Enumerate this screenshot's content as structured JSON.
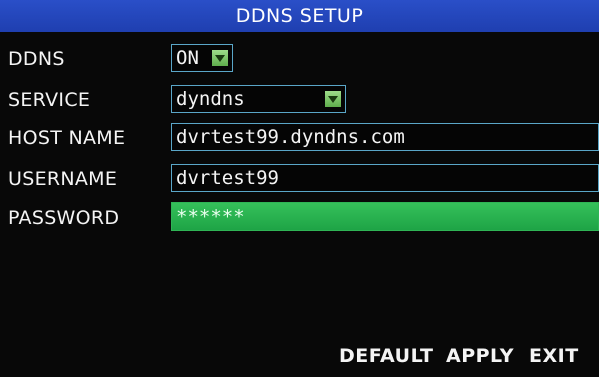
{
  "header": {
    "title": "DDNS SETUP"
  },
  "fields": {
    "ddns": {
      "label": "DDNS",
      "value": "ON"
    },
    "service": {
      "label": "SERVICE",
      "value": "dyndns"
    },
    "host_name": {
      "label": "HOST NAME",
      "value": "dvrtest99.dyndns.com"
    },
    "username": {
      "label": "USERNAME",
      "value": "dvrtest99"
    },
    "password": {
      "label": "PASSWORD",
      "value": "******"
    }
  },
  "footer": {
    "default_label": "DEFAULT",
    "apply_label": "APPLY",
    "exit_label": "EXIT"
  },
  "colors": {
    "title_bar": "#2a4fc8",
    "field_border": "#5aa6c8",
    "password_highlight": "#2bb350",
    "dropdown_button": "#7cc866"
  },
  "icons": {
    "dropdown": "chevron-down-icon"
  }
}
